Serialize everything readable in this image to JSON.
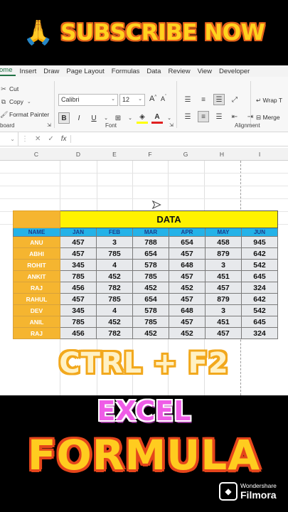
{
  "banner": {
    "emoji": "🙏",
    "text": "SUBSCRIBE NOW"
  },
  "ribbon": {
    "tabs": [
      "ome",
      "Insert",
      "Draw",
      "Page Layout",
      "Formulas",
      "Data",
      "Review",
      "View",
      "Developer"
    ],
    "clipboard": {
      "cut": "Cut",
      "copy": "Copy",
      "format_painter": "Format Painter",
      "label": "board"
    },
    "font": {
      "name": "Calibri",
      "size": "12",
      "grow": "A",
      "shrink": "A",
      "label": "Font",
      "bold": "B",
      "italic": "I",
      "underline": "U"
    },
    "alignment": {
      "wrap": "Wrap T",
      "merge": "Merge",
      "label": "Alignment"
    }
  },
  "formula_bar": {
    "cancel": "✕",
    "confirm": "✓",
    "fx": "fx"
  },
  "columns": [
    "C",
    "D",
    "E",
    "F",
    "G",
    "H",
    "I"
  ],
  "table": {
    "title": "DATA",
    "headers": [
      "NAME",
      "JAN",
      "FEB",
      "MAR",
      "APR",
      "MAY",
      "JUN"
    ],
    "rows": [
      [
        "ANU",
        "457",
        "3",
        "788",
        "654",
        "458",
        "945"
      ],
      [
        "ABHI",
        "457",
        "785",
        "654",
        "457",
        "879",
        "642"
      ],
      [
        "ROHIT",
        "345",
        "4",
        "578",
        "648",
        "3",
        "542"
      ],
      [
        "ANKIT",
        "785",
        "452",
        "785",
        "457",
        "451",
        "645"
      ],
      [
        "RAJ",
        "456",
        "782",
        "452",
        "452",
        "457",
        "324"
      ],
      [
        "RAHUL",
        "457",
        "785",
        "654",
        "457",
        "879",
        "642"
      ],
      [
        "DEV",
        "345",
        "4",
        "578",
        "648",
        "3",
        "542"
      ],
      [
        "ANIL",
        "785",
        "452",
        "785",
        "457",
        "451",
        "645"
      ],
      [
        "RAJ",
        "456",
        "782",
        "452",
        "452",
        "457",
        "324"
      ]
    ]
  },
  "overlay": {
    "shortcut": "CTRL + F2",
    "line1": "EXCEL",
    "line2": "FORMULA"
  },
  "watermark": {
    "line1": "Wondershare",
    "line2": "Filmora"
  },
  "colors": {
    "title_fill": "#fff200",
    "header_fill": "#24b2e8",
    "name_fill": "#f5b530",
    "cell_fill": "#e7e9ec"
  }
}
